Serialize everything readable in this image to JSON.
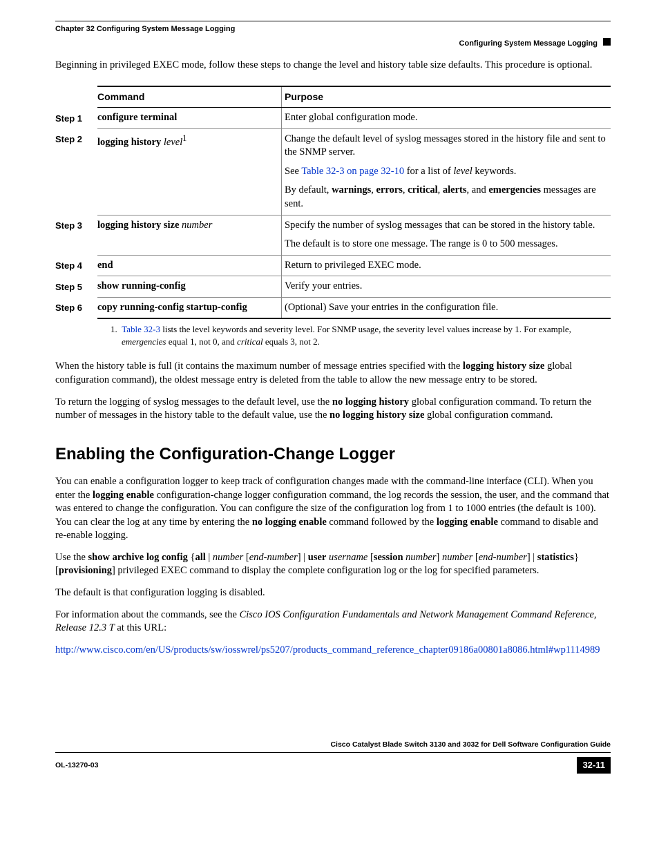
{
  "header": {
    "chapter": "Chapter 32      Configuring System Message Logging",
    "section": "Configuring System Message Logging"
  },
  "intro": "Beginning in privileged EXEC mode, follow these steps to change the level and history table size defaults. This procedure is optional.",
  "table": {
    "head_cmd": "Command",
    "head_purpose": "Purpose",
    "steps": [
      {
        "num": "Step 1",
        "cmd_bold": "configure terminal",
        "cmd_ital": "",
        "sup": "",
        "purpose": [
          {
            "segments": [
              {
                "t": "Enter global configuration mode."
              }
            ]
          }
        ]
      },
      {
        "num": "Step 2",
        "cmd_bold": "logging history ",
        "cmd_ital": "level",
        "sup": "1",
        "purpose": [
          {
            "segments": [
              {
                "t": "Change the default level of syslog messages stored in the history file and sent to the SNMP server."
              }
            ]
          },
          {
            "segments": [
              {
                "t": "See "
              },
              {
                "t": "Table 32-3 on page 32-10",
                "link": true
              },
              {
                "t": " for a list of "
              },
              {
                "t": "level",
                "i": true
              },
              {
                "t": " keywords."
              }
            ]
          },
          {
            "segments": [
              {
                "t": "By default, "
              },
              {
                "t": "warnings",
                "b": true
              },
              {
                "t": ", "
              },
              {
                "t": "errors",
                "b": true
              },
              {
                "t": ", "
              },
              {
                "t": "critical",
                "b": true
              },
              {
                "t": ", "
              },
              {
                "t": "alerts",
                "b": true
              },
              {
                "t": ", and "
              },
              {
                "t": "emergencies",
                "b": true
              },
              {
                "t": " messages are sent."
              }
            ]
          }
        ]
      },
      {
        "num": "Step 3",
        "cmd_bold": "logging history size ",
        "cmd_ital": "number",
        "sup": "",
        "purpose": [
          {
            "segments": [
              {
                "t": "Specify the number of syslog messages that can be stored in the history table."
              }
            ]
          },
          {
            "segments": [
              {
                "t": "The default is to store one message. The range is 0 to 500 messages."
              }
            ]
          }
        ]
      },
      {
        "num": "Step 4",
        "cmd_bold": "end",
        "cmd_ital": "",
        "sup": "",
        "purpose": [
          {
            "segments": [
              {
                "t": "Return to privileged EXEC mode."
              }
            ]
          }
        ]
      },
      {
        "num": "Step 5",
        "cmd_bold": "show running-config",
        "cmd_ital": "",
        "sup": "",
        "purpose": [
          {
            "segments": [
              {
                "t": "Verify your entries."
              }
            ]
          }
        ]
      },
      {
        "num": "Step 6",
        "cmd_bold": "copy running-config startup-config",
        "cmd_ital": "",
        "sup": "",
        "purpose": [
          {
            "segments": [
              {
                "t": "(Optional) Save your entries in the configuration file."
              }
            ]
          }
        ]
      }
    ],
    "footnote_num": "1.",
    "footnote_link": "Table 32-3",
    "footnote_a": " lists the level keywords and severity level. For SNMP usage, the severity level values increase by 1. For example, ",
    "footnote_i1": "emergencies",
    "footnote_b": " equal 1, not 0, and ",
    "footnote_i2": "critical",
    "footnote_c": " equals 3, not 2."
  },
  "after_table": {
    "p1a": "When the history table is full (it contains the maximum number of message entries specified with the ",
    "p1b": "logging history size",
    "p1c": " global configuration command), the oldest message entry is deleted from the table to allow the new message entry to be stored.",
    "p2a": "To return the logging of syslog messages to the default level, use the ",
    "p2b": "no logging history",
    "p2c": " global configuration command. To return the number of messages in the history table to the default value, use the ",
    "p2d": "no logging history size",
    "p2e": " global configuration command."
  },
  "h2": "Enabling the Configuration-Change Logger",
  "sec": {
    "p1a": "You can enable a configuration logger to keep track of configuration changes made with the command-line interface (CLI). When you enter the ",
    "p1b": "logging enable",
    "p1c": " configuration-change logger configuration command, the log records the session, the user, and the command that was entered to change the configuration. You can configure the size of the configuration log from 1 to 1000 entries (the default is 100). You can clear the log at any time by entering the ",
    "p1d": "no logging enable",
    "p1e": " command followed by the ",
    "p1f": "logging enable",
    "p1g": " command to disable and re-enable logging.",
    "p2_pre": "Use the ",
    "p2_b1": "show archive log config",
    "p2_t1": " {",
    "p2_b2": "all",
    "p2_t2": " | ",
    "p2_i1": "number",
    "p2_t3": " [",
    "p2_i2": "end-number",
    "p2_t4": "] | ",
    "p2_b3": "user",
    "p2_t5": " ",
    "p2_i3": "username",
    "p2_t6": " [",
    "p2_b4": "session",
    "p2_t7": " ",
    "p2_i4": "number",
    "p2_t8": "] ",
    "p2_i5": "number",
    "p2_t9": " [",
    "p2_i6": "end-number",
    "p2_t10": "] | ",
    "p2_b5": "statistics",
    "p2_t11": "} [",
    "p2_b6": "provisioning",
    "p2_t12": "] privileged EXEC command to display the complete configuration log or the log for specified parameters.",
    "p3": "The default is that configuration logging is disabled.",
    "p4a": "For information about the commands, see the ",
    "p4i": "Cisco IOS Configuration Fundamentals and Network Management Command Reference, Release 12.3 T",
    "p4b": " at this URL:",
    "url": "http://www.cisco.com/en/US/products/sw/iosswrel/ps5207/products_command_reference_chapter09186a00801a8086.html#wp1114989"
  },
  "footer": {
    "title": "Cisco Catalyst Blade Switch 3130 and 3032 for Dell Software Configuration Guide",
    "doc": "OL-13270-03",
    "page": "32-11"
  }
}
